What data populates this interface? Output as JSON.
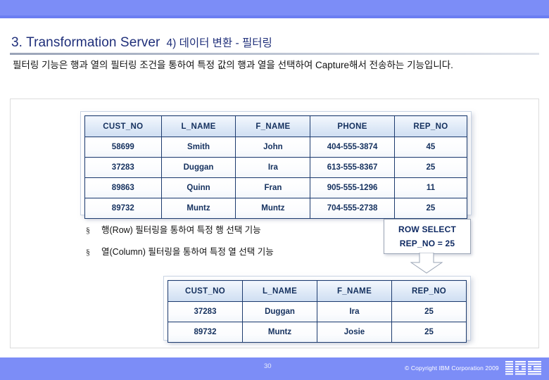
{
  "slide": {
    "title_main": "3. Transformation Server",
    "title_sub": "4) 데이터 변환 - 필터링",
    "description": "필터링 기능은 행과 열의 필터링 조건을 통하여 특정 값의 행과 열을 선택하여 Capture해서 전송하는 기능입니다.",
    "accent_color": "#7c8df7",
    "title_color": "#1f2f7a"
  },
  "source_table": {
    "columns": [
      "CUST_NO",
      "L_NAME",
      "F_NAME",
      "PHONE",
      "REP_NO"
    ],
    "rows": [
      [
        "58699",
        "Smith",
        "John",
        "404-555-3874",
        "45"
      ],
      [
        "37283",
        "Duggan",
        "Ira",
        "613-555-8367",
        "25"
      ],
      [
        "89863",
        "Quinn",
        "Fran",
        "905-555-1296",
        "11"
      ],
      [
        "89732",
        "Muntz",
        "Muntz",
        "704-555-2738",
        "25"
      ]
    ]
  },
  "bullets": [
    {
      "marker": "§",
      "text": "행(Row) 필터링을 통하여 특정 행 선택 기능"
    },
    {
      "marker": "§",
      "text": "열(Column) 필터링을 통하여 특정 열 선택 기능"
    }
  ],
  "callout": {
    "line1": "ROW SELECT",
    "line2": "REP_NO = 25"
  },
  "result_table": {
    "columns": [
      "CUST_NO",
      "L_NAME",
      "F_NAME",
      "REP_NO"
    ],
    "rows": [
      [
        "37283",
        "Duggan",
        "Ira",
        "25"
      ],
      [
        "89732",
        "Muntz",
        "Josie",
        "25"
      ]
    ]
  },
  "footer": {
    "page_number": "30",
    "copyright": "© Copyright IBM Corporation 2009",
    "logo": "ibm-logo"
  }
}
